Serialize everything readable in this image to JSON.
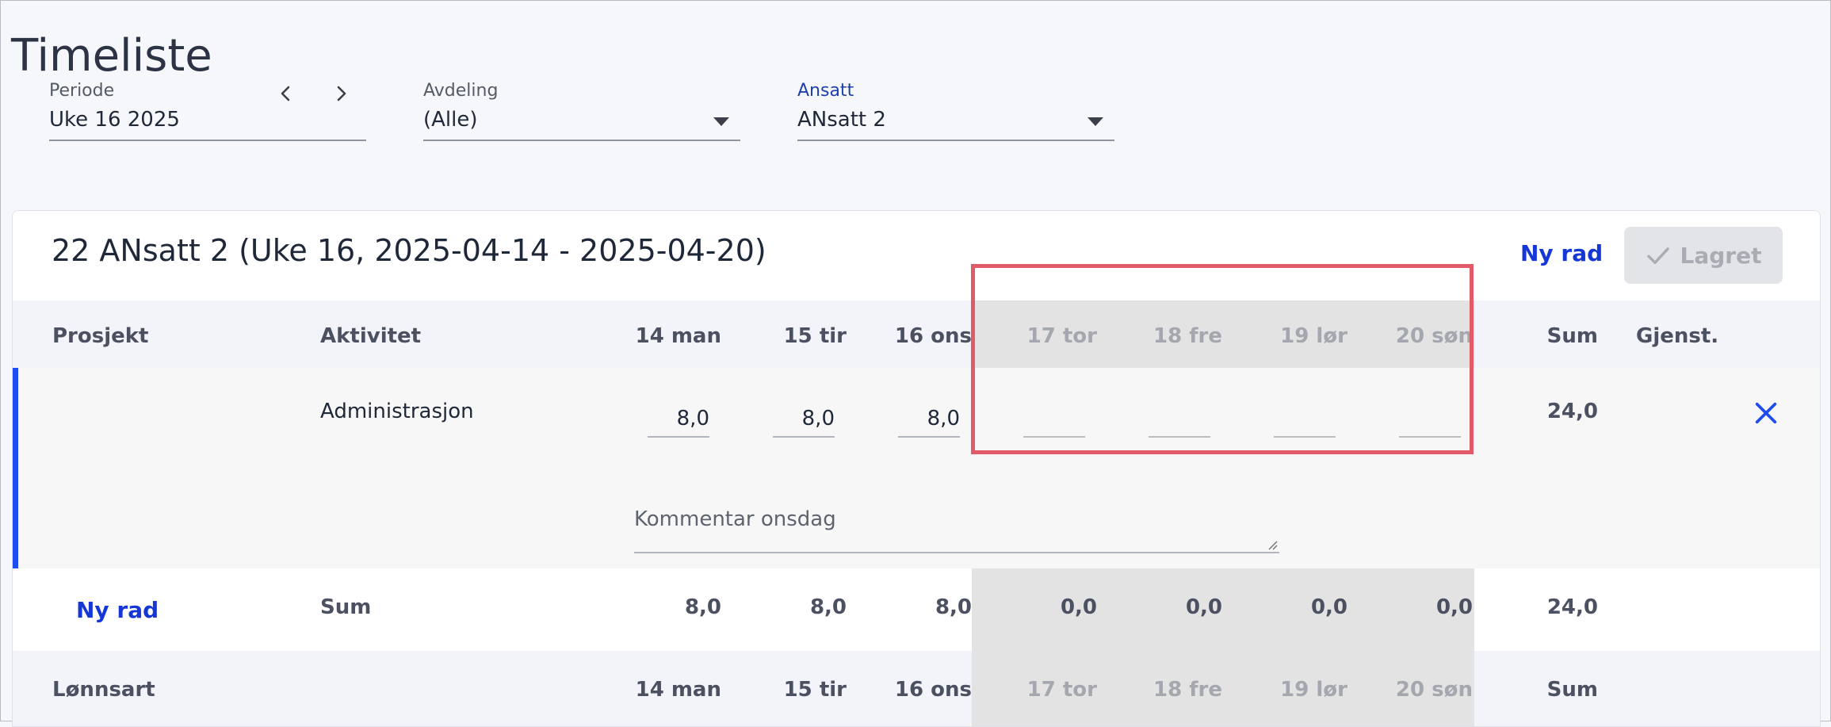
{
  "page": {
    "title": "Timeliste"
  },
  "filters": {
    "periode": {
      "label": "Periode",
      "value": "Uke 16 2025"
    },
    "avdeling": {
      "label": "Avdeling",
      "value": "(Alle)"
    },
    "ansatt": {
      "label": "Ansatt",
      "value": "ANsatt 2"
    }
  },
  "card": {
    "title": "22 ANsatt 2 (Uke 16, 2025-04-14 - 2025-04-20)",
    "new_row_label": "Ny rad",
    "saved_label": "Lagret"
  },
  "table": {
    "headers": {
      "project": "Prosjekt",
      "activity": "Aktivitet",
      "days": [
        "14 man",
        "15 tir",
        "16 ons",
        "17 tor",
        "18 fre",
        "19 lør",
        "20 søn"
      ],
      "sum": "Sum",
      "remaining": "Gjenst."
    },
    "rows": [
      {
        "project": "",
        "activity": "Administrasjon",
        "hours": [
          "8,0",
          "8,0",
          "8,0",
          "",
          "",
          "",
          ""
        ],
        "sum": "24,0",
        "comment_placeholder": "Kommentar onsdag"
      }
    ],
    "totals": {
      "new_row_label": "Ny rad",
      "label": "Sum",
      "values": [
        "8,0",
        "8,0",
        "8,0",
        "0,0",
        "0,0",
        "0,0",
        "0,0"
      ],
      "sum": "24,0"
    }
  },
  "lonn": {
    "header": "Lønnsart",
    "days": [
      "14 man",
      "15 tir",
      "16 ons",
      "17 tor",
      "18 fre",
      "19 lør",
      "20 søn"
    ],
    "sum": "Sum"
  },
  "colors": {
    "accent": "#1537d6",
    "highlight": "#e25a67",
    "weekend": "#e3e3e3"
  }
}
